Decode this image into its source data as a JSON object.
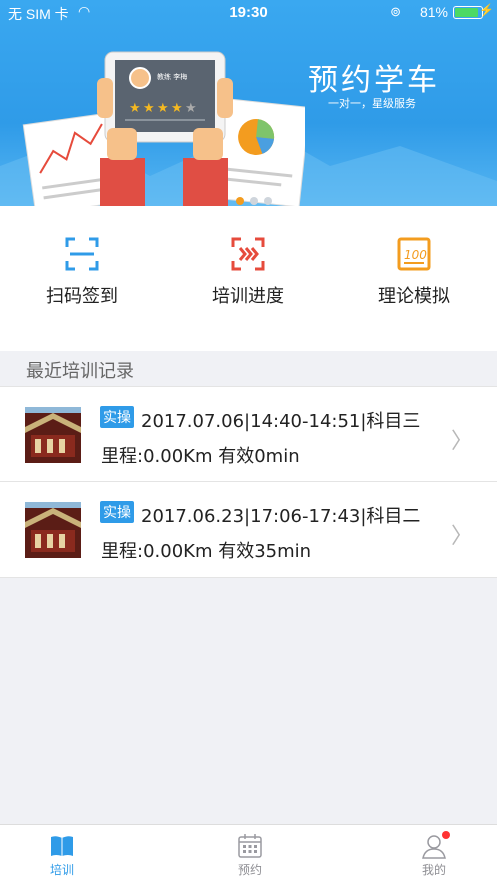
{
  "status_bar": {
    "carrier": "无 SIM 卡",
    "time": "19:30",
    "battery": "81%",
    "battery_level": 0.81
  },
  "banner": {
    "title": "预约学车",
    "subtitle": "一对一，星级服务",
    "card_label": "教练 李梅",
    "rating_stars": 4,
    "rating_max": 5
  },
  "actions": [
    {
      "label": "扫码签到",
      "icon": "scan-icon"
    },
    {
      "label": "培训进度",
      "icon": "progress-icon"
    },
    {
      "label": "理论模拟",
      "icon": "exam-icon"
    }
  ],
  "section": {
    "title": "最近培训记录"
  },
  "records": [
    {
      "tag": "实操",
      "line1": "2017.07.06|14:40-14:51|科目三",
      "line2": "里程:0.00Km 有效0min"
    },
    {
      "tag": "实操",
      "line1": "2017.06.23|17:06-17:43|科目二",
      "line2": "里程:0.00Km 有效35min"
    }
  ],
  "tabs": [
    {
      "label": "培训",
      "icon": "book-icon",
      "active": true
    },
    {
      "label": "预约",
      "icon": "calendar-icon",
      "active": false
    },
    {
      "label": "我的",
      "icon": "user-icon",
      "active": false
    }
  ],
  "colors": {
    "brand": "#2f9be8",
    "scan": "#2f9be8",
    "progress": "#e64b3c",
    "exam": "#f39c1f"
  }
}
